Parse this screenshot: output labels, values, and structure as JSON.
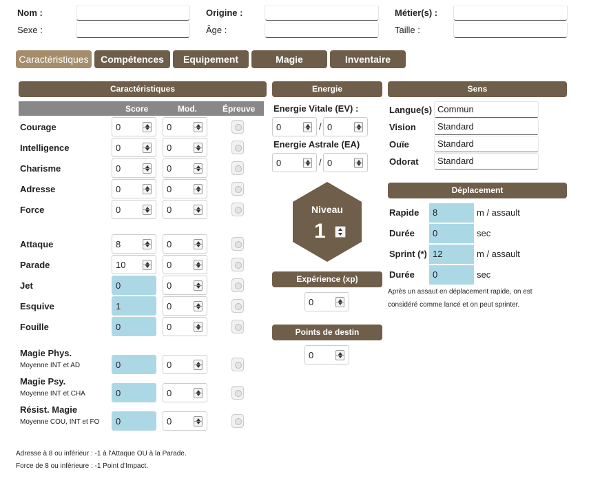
{
  "header": {
    "nom": "Nom :",
    "origine": "Origine :",
    "metier": "Métier(s) :",
    "sexe": "Sexe :",
    "age": "Âge :",
    "taille": "Taille :"
  },
  "tabs": [
    "Caractéristiques",
    "Compétences",
    "Equipement",
    "Magie",
    "Inventaire"
  ],
  "caracteristiques": {
    "title": "Caractéristiques",
    "cols": {
      "score": "Score",
      "mod": "Mod.",
      "epreuve": "Épreuve"
    },
    "rows": [
      {
        "label": "Courage",
        "score": "0",
        "mod": "0"
      },
      {
        "label": "Intelligence",
        "score": "0",
        "mod": "0"
      },
      {
        "label": "Charisme",
        "score": "0",
        "mod": "0"
      },
      {
        "label": "Adresse",
        "score": "0",
        "mod": "0"
      },
      {
        "label": "Force",
        "score": "0",
        "mod": "0"
      },
      {
        "label": "Attaque",
        "score": "8",
        "mod": "0"
      },
      {
        "label": "Parade",
        "score": "10",
        "mod": "0"
      },
      {
        "label": "Jet",
        "score": "0",
        "mod": "0"
      },
      {
        "label": "Esquive",
        "score": "1",
        "mod": "0"
      },
      {
        "label": "Fouille",
        "score": "0",
        "mod": "0"
      },
      {
        "label": "Magie Phys.",
        "sub": "Moyenne INT et AD",
        "score": "0",
        "mod": "0"
      },
      {
        "label": "Magie Psy.",
        "sub": "Moyenne INT et CHA",
        "score": "0",
        "mod": "0"
      },
      {
        "label": "Résist. Magie",
        "sub": "Moyenne COU, INT et FO",
        "score": "0",
        "mod": "0"
      }
    ],
    "notes": [
      "Adresse à 8 ou inférieur : -1 à l'Attaque OU à la Parade.",
      "Force de 8 ou inférieure : -1 Point d'Impact."
    ]
  },
  "energie": {
    "title": "Energie",
    "ev_label": "Energie Vitale (EV) :",
    "ev": "0",
    "ev_max": "0",
    "ea_label": "Energie Astrale (EA)",
    "ea": "0",
    "ea_max": "0",
    "sep": "/"
  },
  "niveau": {
    "title": "Niveau",
    "value": "1"
  },
  "experience": {
    "title": "Expérience (xp)",
    "value": "0"
  },
  "destin": {
    "title": "Points de destin",
    "value": "0"
  },
  "sens": {
    "title": "Sens",
    "rows": [
      {
        "label": "Langue(s)",
        "value": "Commun"
      },
      {
        "label": "Vision",
        "value": "Standard"
      },
      {
        "label": "Ouïe",
        "value": "Standard"
      },
      {
        "label": "Odorat",
        "value": "Standard"
      }
    ]
  },
  "deplacement": {
    "title": "Déplacement",
    "rows": [
      {
        "label": "Rapide",
        "value": "8",
        "unit": "m / assault"
      },
      {
        "label": "Durée",
        "value": "0",
        "unit": "sec"
      },
      {
        "label": "Sprint (*)",
        "value": "12",
        "unit": "m / assault"
      },
      {
        "label": "Durée",
        "value": "0",
        "unit": "sec"
      }
    ],
    "note1": "Après un assaut en déplacement rapide, on est",
    "note2": "considéré comme lancé et on peut sprinter."
  },
  "colors": {
    "brown": "#6f5e49",
    "active_tab": "#a58d6b",
    "blue": "#acd8e6",
    "header_grey": "#888888"
  }
}
